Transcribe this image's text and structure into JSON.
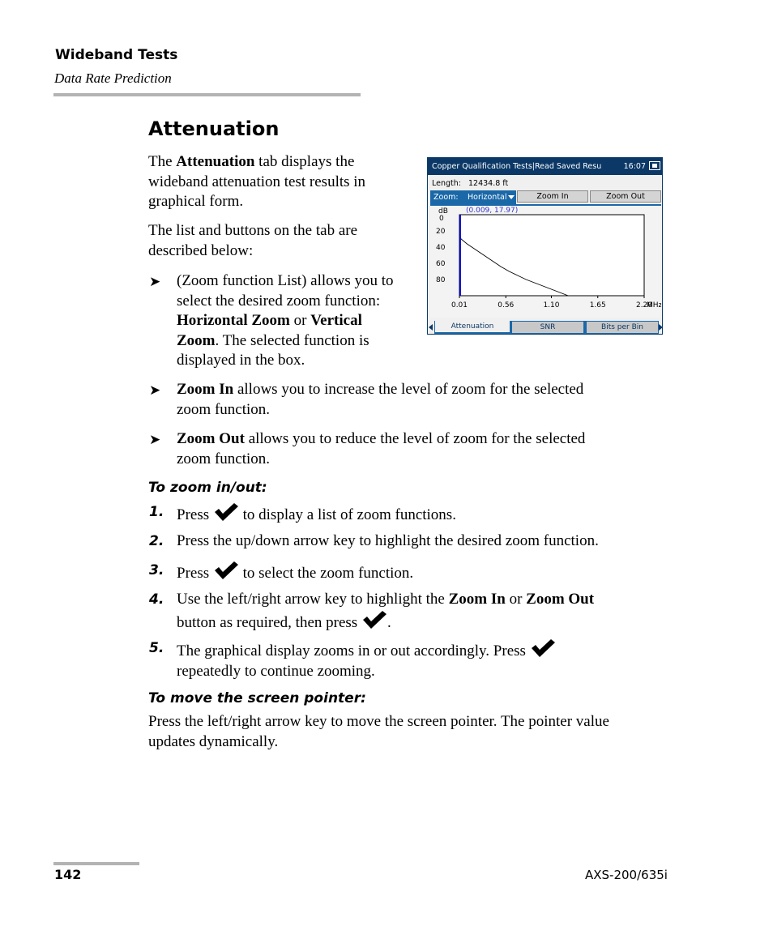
{
  "header": {
    "chapter": "Wideband Tests",
    "section": "Data Rate Prediction"
  },
  "section_title": "Attenuation",
  "intro": {
    "p1_prefix": "The ",
    "p1_bold": "Attenuation",
    "p1_suffix_l1": " tab displays the",
    "p1_l2": "wideband attenuation test results in",
    "p1_l3": "graphical form.",
    "p2_l1": "The list and buttons on the tab are",
    "p2_l2": "described below:"
  },
  "bullets": [
    {
      "l1": "(Zoom function List) allows you to",
      "l2": "select the desired zoom function:",
      "l3_b1": "Horizontal Zoom",
      "l3_mid": " or ",
      "l3_b2": "Vertical",
      "l4_b": "Zoom",
      "l4_rest": ". The selected function is",
      "l5": "displayed in the box."
    },
    {
      "bold": "Zoom In",
      "l1": " allows you to increase the level of zoom for the selected",
      "l2": "zoom function."
    },
    {
      "bold": "Zoom Out",
      "l1": " allows you to reduce the level of zoom for the selected",
      "l2": "zoom function."
    }
  ],
  "bullet_glyph": "➤",
  "procedure_zoom": {
    "title": "To zoom in/out:",
    "steps": [
      {
        "num": "1.",
        "pre": "Press ",
        "post": " to display a list of zoom functions."
      },
      {
        "num": "2.",
        "text": "Press the up/down arrow key to highlight the desired zoom function."
      },
      {
        "num": "3.",
        "pre": "Press ",
        "post": " to select the zoom function."
      },
      {
        "num": "4.",
        "l1_pre": "Use the left/right arrow key to highlight the ",
        "b1": "Zoom In",
        "mid": " or ",
        "b2": "Zoom Out",
        "l2_pre": "button as required, then press ",
        "l2_post": "."
      },
      {
        "num": "5.",
        "l1": "The graphical display zooms in or out accordingly. Press ",
        "l2": "repeatedly to continue zooming."
      }
    ]
  },
  "procedure_pointer": {
    "title": "To move the screen pointer:",
    "l1": "Press the left/right arrow key to move the screen pointer. The pointer value",
    "l2": "updates dynamically."
  },
  "footer": {
    "page": "142",
    "model": "AXS-200/635i"
  },
  "device": {
    "title": "Copper Qualification Tests|Read Saved Resu",
    "time": "16:07",
    "length_label": "Length:",
    "length_value": "12434.8 ft",
    "zoom_label": "Zoom:",
    "zoom_value": "Horizontal",
    "zoom_in": "Zoom In",
    "zoom_out": "Zoom Out",
    "tabs": [
      "Attenuation",
      "SNR",
      "Bits per Bin"
    ],
    "active_tab": "Attenuation",
    "colors": {
      "titlebar": "#0b3866",
      "accent": "#1a68a8",
      "cursor": "#0000cc",
      "readout": "#3333cc"
    }
  },
  "chart_data": {
    "type": "line",
    "title": "",
    "xlabel": "MHz",
    "ylabel": "dB",
    "x_ticks": [
      "0.01",
      "0.56",
      "1.10",
      "1.65",
      "2.20"
    ],
    "y_ticks": [
      "0",
      "20",
      "40",
      "60",
      "80"
    ],
    "xlim": [
      0.01,
      2.2
    ],
    "ylim": [
      0,
      100
    ],
    "y_inverted": true,
    "cursor": {
      "x": 0.009,
      "y": 17.97,
      "readout": "(0.009, 17.97)"
    },
    "series": [
      {
        "name": "Attenuation",
        "x": [
          0.01,
          0.03,
          0.1,
          0.2,
          0.3,
          0.4,
          0.5,
          0.6,
          0.7,
          0.8,
          0.9,
          1.0,
          1.1,
          1.2,
          1.3
        ],
        "y": [
          25,
          30,
          36,
          43,
          50,
          57,
          64,
          70,
          75,
          80,
          84,
          88,
          92,
          96,
          100
        ]
      }
    ]
  }
}
